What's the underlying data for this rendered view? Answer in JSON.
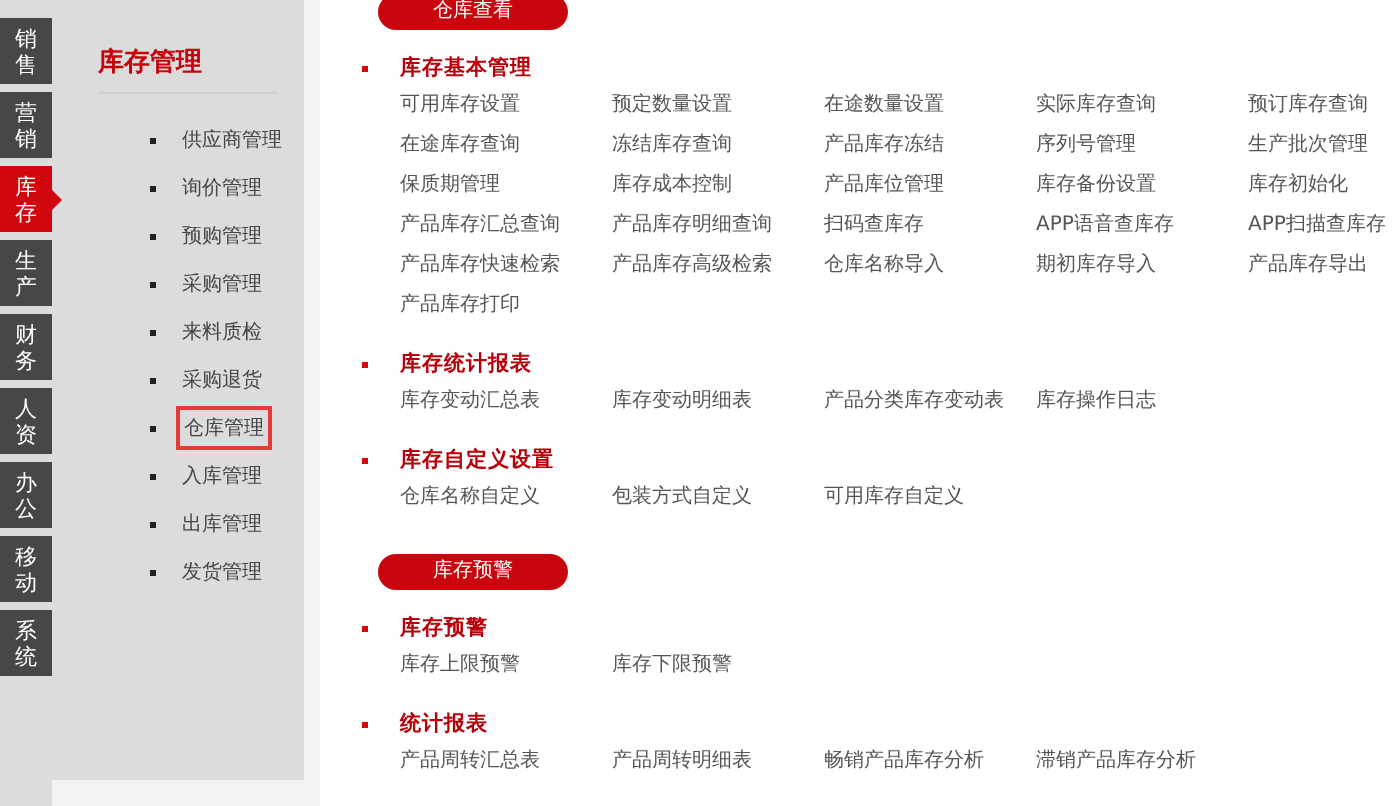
{
  "nav_tabs": [
    {
      "label": "销售",
      "selected": false
    },
    {
      "label": "营销",
      "selected": false
    },
    {
      "label": "库存",
      "selected": true
    },
    {
      "label": "生产",
      "selected": false
    },
    {
      "label": "财务",
      "selected": false
    },
    {
      "label": "人资",
      "selected": false
    },
    {
      "label": "办公",
      "selected": false
    },
    {
      "label": "移动",
      "selected": false
    },
    {
      "label": "系统",
      "selected": false
    }
  ],
  "sidebar": {
    "title": "库存管理",
    "items": [
      {
        "label": "供应商管理",
        "selected": false
      },
      {
        "label": "询价管理",
        "selected": false
      },
      {
        "label": "预购管理",
        "selected": false
      },
      {
        "label": "采购管理",
        "selected": false
      },
      {
        "label": "来料质检",
        "selected": false
      },
      {
        "label": "采购退货",
        "selected": false
      },
      {
        "label": "仓库管理",
        "selected": true
      },
      {
        "label": "入库管理",
        "selected": false
      },
      {
        "label": "出库管理",
        "selected": false
      },
      {
        "label": "发货管理",
        "selected": false
      }
    ]
  },
  "panels": [
    {
      "title": "仓库查看",
      "sections": [
        {
          "heading": "库存基本管理",
          "links": [
            "可用库存设置",
            "预定数量设置",
            "在途数量设置",
            "实际库存查询",
            "预订库存查询",
            "在途库存查询",
            "冻结库存查询",
            "产品库存冻结",
            "序列号管理",
            "生产批次管理",
            "保质期管理",
            "库存成本控制",
            "产品库位管理",
            "库存备份设置",
            "库存初始化",
            "产品库存汇总查询",
            "产品库存明细查询",
            "扫码查库存",
            "APP语音查库存",
            "APP扫描查库存",
            "产品库存快速检索",
            "产品库存高级检索",
            "仓库名称导入",
            "期初库存导入",
            "产品库存导出",
            "产品库存打印"
          ]
        },
        {
          "heading": "库存统计报表",
          "links": [
            "库存变动汇总表",
            "库存变动明细表",
            "产品分类库存变动表",
            "库存操作日志"
          ]
        },
        {
          "heading": "库存自定义设置",
          "links": [
            "仓库名称自定义",
            "包装方式自定义",
            "可用库存自定义"
          ]
        }
      ]
    },
    {
      "title": "库存预警",
      "sections": [
        {
          "heading": "库存预警",
          "links": [
            "库存上限预警",
            "库存下限预警"
          ]
        },
        {
          "heading": "统计报表",
          "links": [
            "产品周转汇总表",
            "产品周转明细表",
            "畅销产品库存分析",
            "滞销产品库存分析"
          ]
        }
      ]
    }
  ]
}
